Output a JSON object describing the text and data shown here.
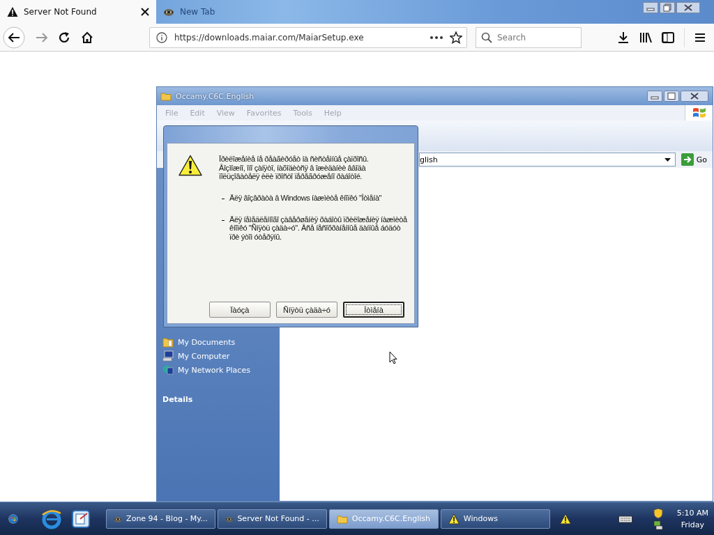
{
  "browser": {
    "tabs": [
      {
        "title": "Server Not Found",
        "selected": true,
        "kind": "warning"
      },
      {
        "title": "New Tab",
        "selected": false,
        "kind": "raccoon"
      }
    ],
    "url": "https://downloads.maiar.com/MaiarSetup.exe",
    "search": {
      "placeholder": "Search"
    }
  },
  "explorer": {
    "title": "Occamy.C6C.English",
    "menu": [
      "File",
      "Edit",
      "View",
      "Favorites",
      "Tools",
      "Help"
    ],
    "address": "glish",
    "go": "Go",
    "places": [
      {
        "label": "My Documents",
        "kind": "documents"
      },
      {
        "label": "My Computer",
        "kind": "computer"
      },
      {
        "label": "My Network Places",
        "kind": "network"
      }
    ],
    "details": "Details"
  },
  "dialog": {
    "message": "Ïðèëîæåíèå íå ðåàãèðóåò íà ñèñòåìíûå çàïðîñû. Âîçìîæíî, îíî çàíÿòî, íàõîäèòñÿ â îæèäàíèè ââîäà ïîëüçîâàòåëÿ èëè ïðîñòî ïåðåãðóæåíî ðàáîòîé.",
    "bullets": [
      "Äëÿ âîçâðàòà â Windows íàæìèòå êíîïêó \"Îòìåíà\"",
      "Äëÿ íåìåäëåííîãî çàâåðøåíèÿ ðàáîòû ïðèëîæåíèÿ íàæìèòå êíîïêó \"Ñíÿòü çàäà÷ó\". Âñå íåñîõðàíåííûå äàííûå áóäóò ïðè ýòîì óòåðÿíû."
    ],
    "buttons": [
      {
        "label": "Ïàóçà",
        "default": false
      },
      {
        "label": "Ñíÿòü çàäà÷ó",
        "default": false
      },
      {
        "label": "Îòìåíà",
        "default": true
      }
    ]
  },
  "taskbar": {
    "tasks": [
      {
        "label": "Zone 94 - Blog - My...",
        "kind": "raccoon",
        "selected": false
      },
      {
        "label": "Server Not Found - ...",
        "kind": "raccoon",
        "selected": false
      },
      {
        "label": "Occamy.C6C.English",
        "kind": "folder",
        "selected": true
      },
      {
        "label": "Windows",
        "kind": "warning",
        "selected": false
      }
    ],
    "time": "5:10 AM",
    "day": "Friday"
  }
}
